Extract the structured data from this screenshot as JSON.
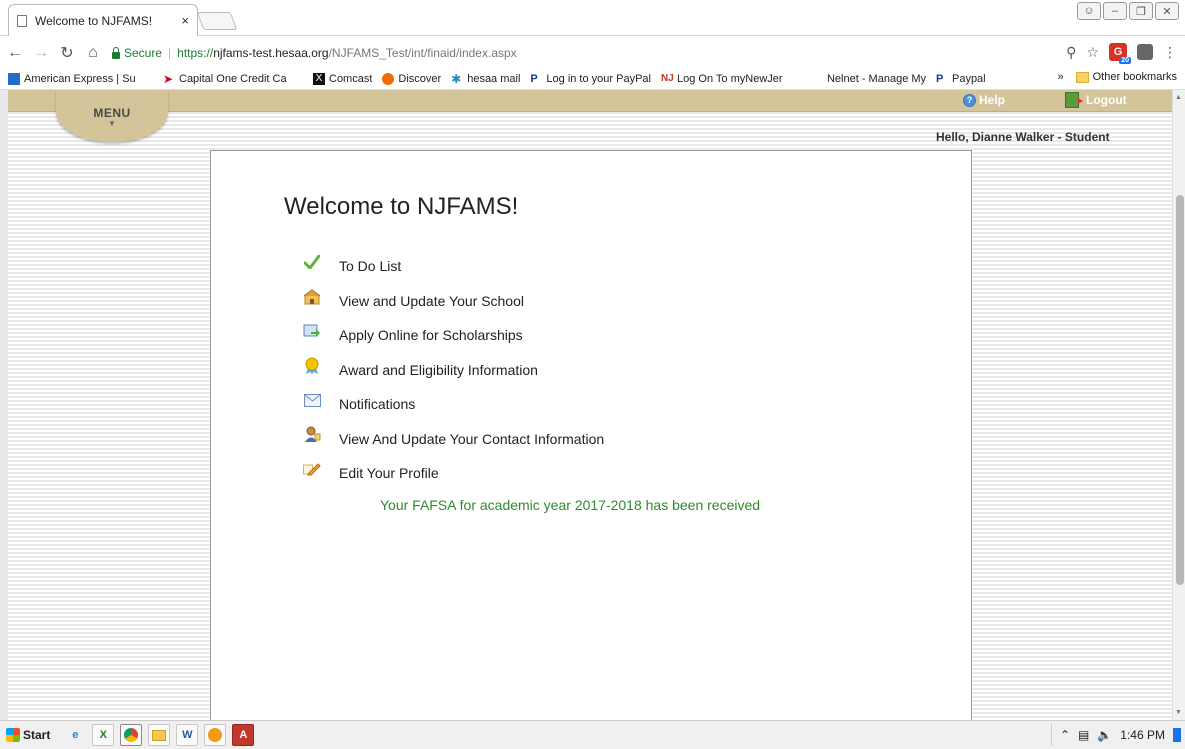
{
  "browser": {
    "tab_title": "Welcome to NJFAMS!",
    "tab_close": "×",
    "secure_label": "Secure",
    "url_scheme": "https://",
    "url_host": "njfams-test.hesaa.org",
    "url_path": "/NJFAMS_Test/int/finaid/index.aspx",
    "ext_badge": "20",
    "bookmarks": [
      {
        "label": "American Express | Su",
        "color": "#1f6fc5"
      },
      {
        "label": "Capital One Credit Ca",
        "color": "#d0021b"
      },
      {
        "label": "Comcast",
        "color": "#111111"
      },
      {
        "label": "Discover",
        "color": "#f26b00"
      },
      {
        "label": "hesaa mail",
        "color": "#1e88c9"
      },
      {
        "label": "Log in to your PayPal",
        "color": "#1b3d8f"
      },
      {
        "label": "Log On To myNewJer",
        "color": "#c0392b"
      },
      {
        "label": "Nelnet - Manage My",
        "color": "#ffffff"
      },
      {
        "label": "Paypal",
        "color": "#1b3d8f"
      }
    ],
    "bookmarks_overflow": "»",
    "other_bookmarks": "Other bookmarks"
  },
  "header": {
    "menu_label": "MENU",
    "help_label": "Help",
    "logout_label": "Logout",
    "greeting": "Hello, Dianne Walker - Student"
  },
  "main": {
    "title": "Welcome to NJFAMS!",
    "items": [
      {
        "label": "To Do List",
        "icon": "checkmark-icon"
      },
      {
        "label": "View and Update Your School",
        "icon": "school-icon"
      },
      {
        "label": "Apply Online for Scholarships",
        "icon": "apply-icon"
      },
      {
        "label": "Award and Eligibility Information",
        "icon": "award-icon"
      },
      {
        "label": "Notifications",
        "icon": "envelope-icon"
      },
      {
        "label": "View And Update Your Contact Information",
        "icon": "contact-icon"
      },
      {
        "label": "Edit Your Profile",
        "icon": "pencil-icon"
      }
    ],
    "fafsa_message": "Your FAFSA for academic year 2017-2018 has been received"
  },
  "taskbar": {
    "start_label": "Start",
    "time": "1:46 PM"
  }
}
